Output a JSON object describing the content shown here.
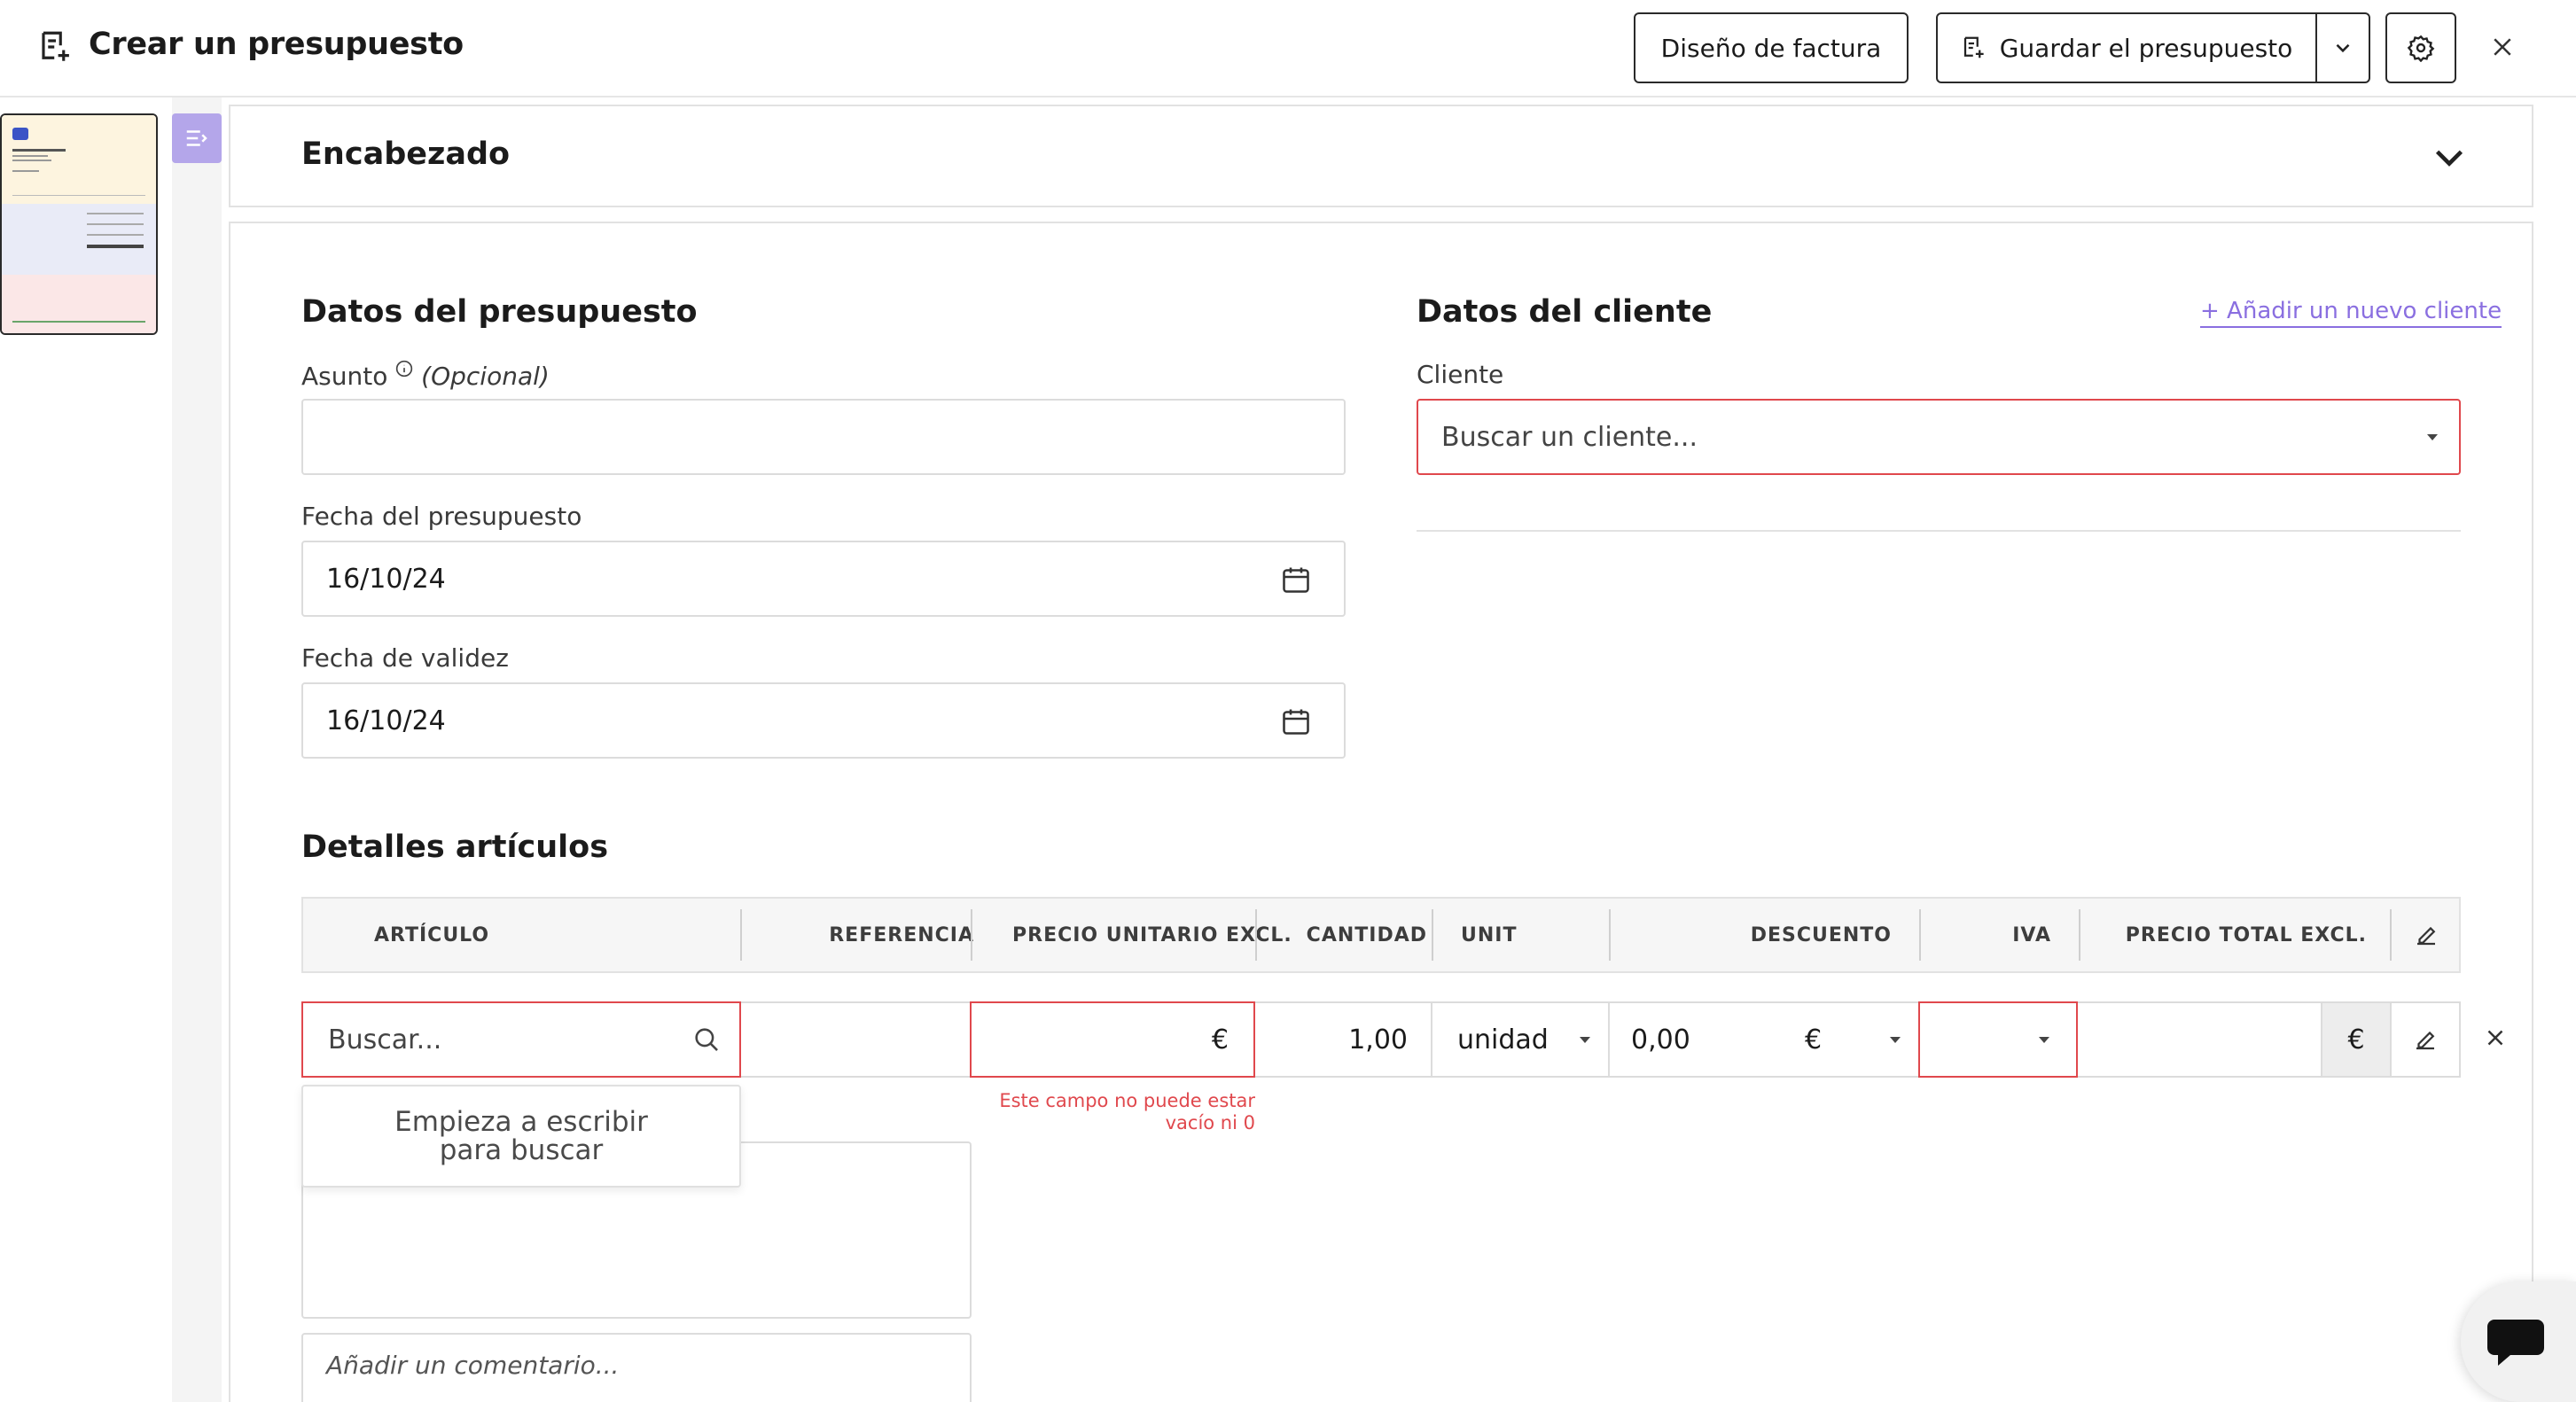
{
  "topbar": {
    "title": "Crear un presupuesto",
    "design_button": "Diseño de factura",
    "save_button": "Guardar el presupuesto"
  },
  "header_panel": {
    "title": "Encabezado"
  },
  "quote_data": {
    "title": "Datos del presupuesto",
    "subject_label": "Asunto",
    "subject_optional": "(Opcional)",
    "subject_value": "",
    "date_label": "Fecha del presupuesto",
    "date_value": "16/10/24",
    "validity_label": "Fecha de validez",
    "validity_value": "16/10/24"
  },
  "client_data": {
    "title": "Datos del cliente",
    "add_client_link": "+ Añadir un nuevo cliente",
    "client_label": "Cliente",
    "client_placeholder": "Buscar un cliente..."
  },
  "items": {
    "title": "Detalles artículos",
    "columns": [
      "ARTÍCULO",
      "REFERENCIA",
      "PRECIO UNITARIO EXCL.",
      "CANTIDAD",
      "UNIT",
      "DESCUENTO",
      "IVA",
      "PRECIO TOTAL EXCL."
    ],
    "row": {
      "search_placeholder": "Buscar...",
      "reference": "",
      "unit_price_currency": "€",
      "quantity": "1,00",
      "unit": "unidad",
      "discount": "0,00",
      "discount_currency": "€",
      "vat": "",
      "total": "",
      "total_currency": "€"
    },
    "error_message": "Este campo no puede estar vacío ni 0",
    "search_hint": "Empieza a escribir para buscar",
    "comment_placeholder": "Añadir un comentario..."
  },
  "colors": {
    "accent": "#8a6fe0",
    "sidebar_toggle": "#b4a6ea",
    "error": "#e0484d",
    "border": "#dcdcdc"
  }
}
